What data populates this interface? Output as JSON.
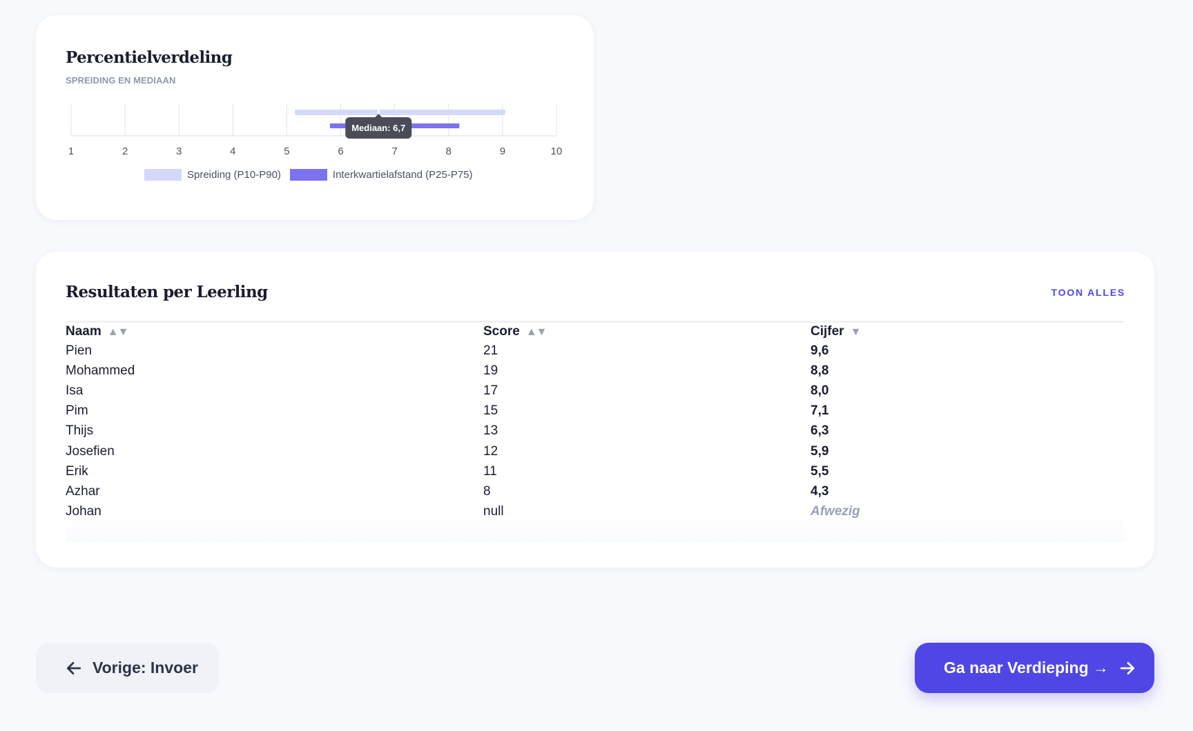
{
  "percentile_card": {
    "title": "Percentielverdeling",
    "subtitle": "SPREIDING EN MEDIAAN",
    "legend": [
      {
        "label": "Spreiding (P10-P90)",
        "color": "#d4d8fb"
      },
      {
        "label": "Interkwartielafstand (P25-P75)",
        "color": "#7c72ee"
      }
    ],
    "tooltip": "Mediaan: 6,7"
  },
  "chart_data": {
    "type": "bar",
    "orientation": "horizontal-range",
    "x_ticks": [
      "1",
      "2",
      "3",
      "4",
      "5",
      "6",
      "7",
      "8",
      "9",
      "10"
    ],
    "xlim": [
      1,
      10
    ],
    "grid": true,
    "legend_position": "bottom",
    "series": [
      {
        "name": "Spreiding (P10-P90)",
        "from": 5.15,
        "to": 9.05,
        "color": "#d4d8fb"
      },
      {
        "name": "Interkwartielafstand (P25-P75)",
        "from": 5.8,
        "to": 8.2,
        "color": "#7c72ee"
      }
    ],
    "median": 6.7,
    "annotations": [
      "Mediaan: 6,7"
    ]
  },
  "results_card": {
    "title": "Resultaten per Leerling",
    "show_all": "TOON ALLES",
    "columns": [
      {
        "label": "Naam",
        "sort_icon": "sort-both-icon"
      },
      {
        "label": "Score",
        "sort_icon": "sort-both-icon"
      },
      {
        "label": "Cijfer",
        "sort_icon": "sort-desc-icon"
      }
    ],
    "rows": [
      {
        "name": "Pien",
        "score": "21",
        "grade": "9,6"
      },
      {
        "name": "Mohammed",
        "score": "19",
        "grade": "8,8"
      },
      {
        "name": "Isa",
        "score": "17",
        "grade": "8,0"
      },
      {
        "name": "Pim",
        "score": "15",
        "grade": "7,1"
      },
      {
        "name": "Thijs",
        "score": "13",
        "grade": "6,3"
      },
      {
        "name": "Josefien",
        "score": "12",
        "grade": "5,9"
      },
      {
        "name": "Erik",
        "score": "11",
        "grade": "5,5"
      },
      {
        "name": "Azhar",
        "score": "8",
        "grade": "4,3"
      },
      {
        "name": "Johan",
        "score": "null",
        "grade": "Afwezig"
      }
    ]
  },
  "navigation": {
    "prev_label": "Vorige: Invoer",
    "next_label": "Ga naar Verdieping →"
  },
  "colors": {
    "accent": "#4f46e5",
    "range_light": "#d4d8fb",
    "range_dark": "#7c72ee"
  }
}
